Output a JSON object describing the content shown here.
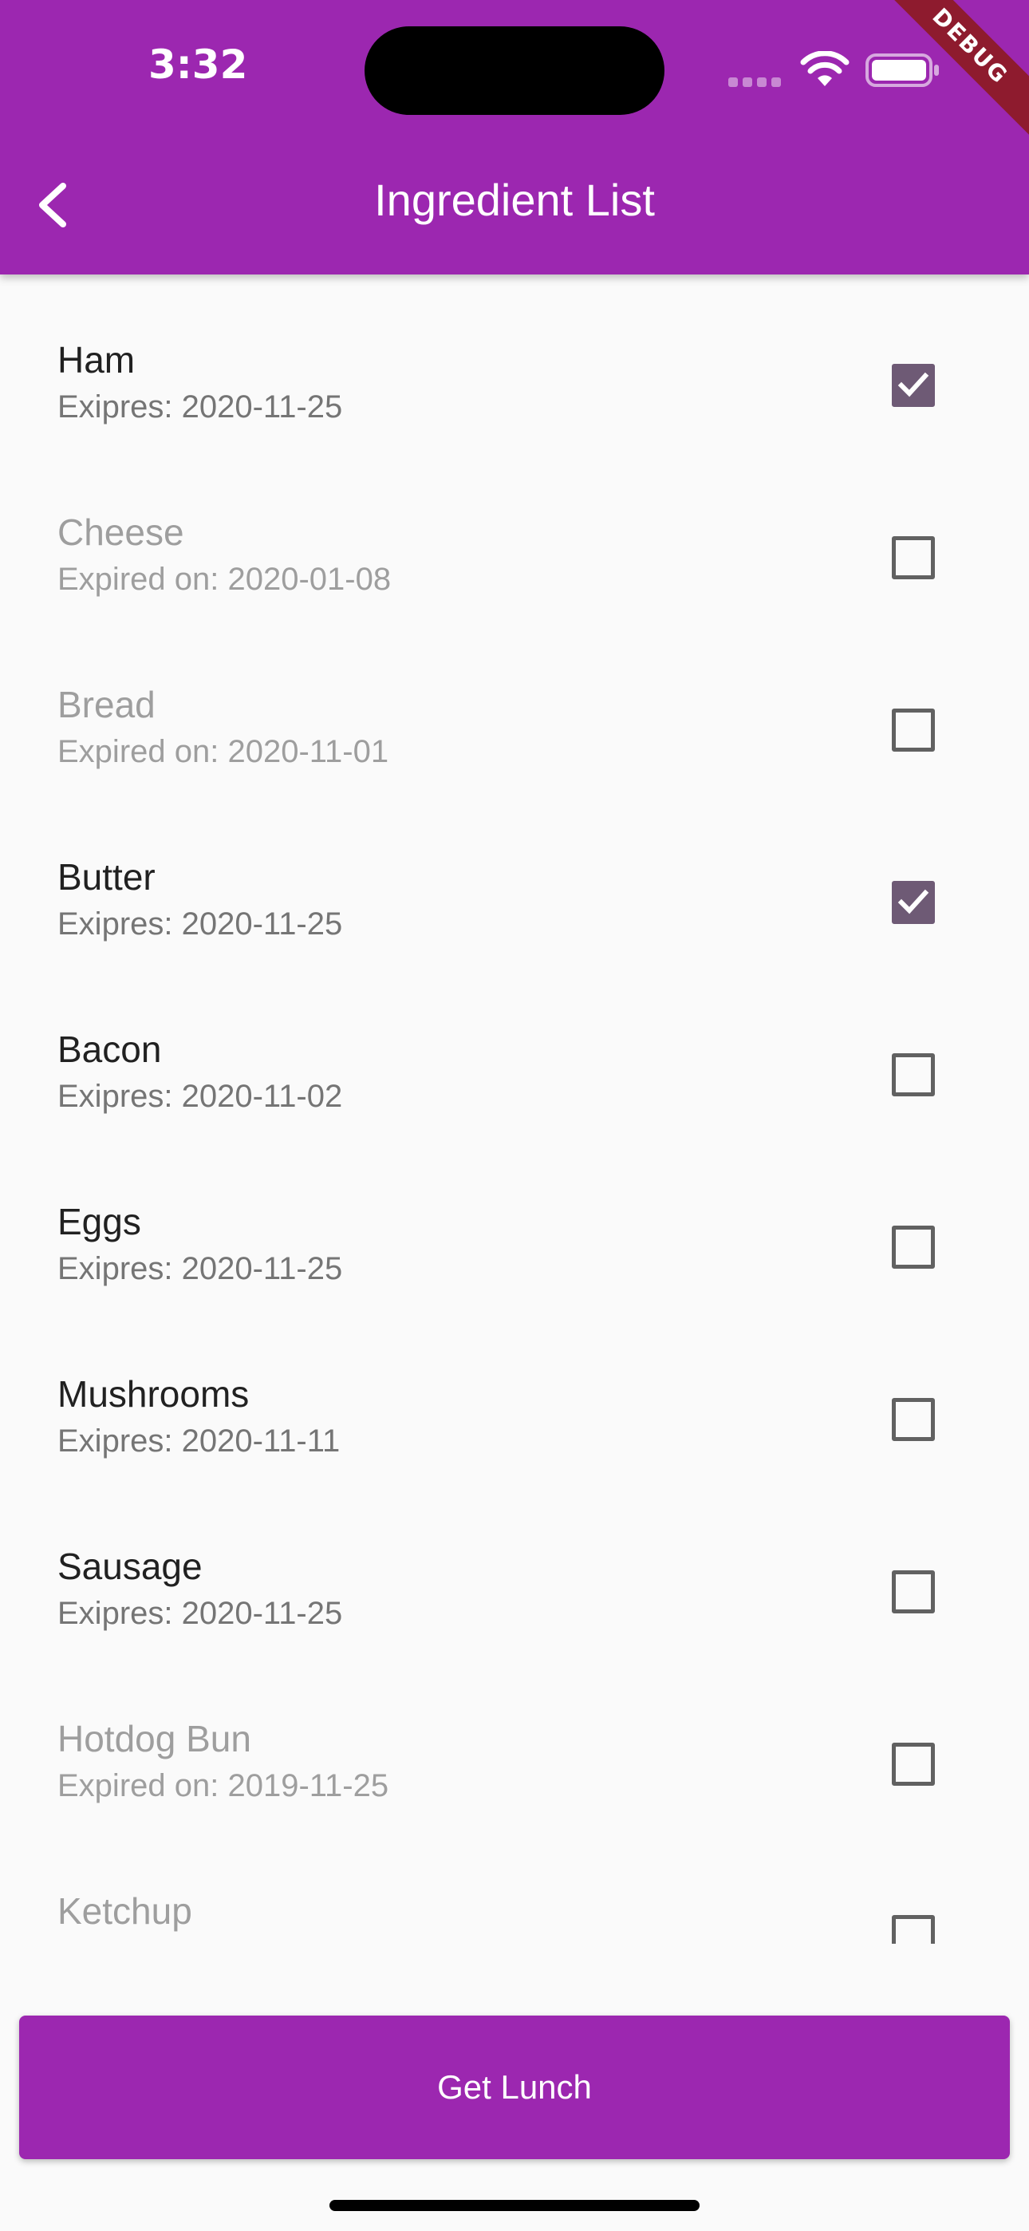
{
  "status_bar": {
    "time": "3:32",
    "debug_label": "DEBUG"
  },
  "app_bar": {
    "title": "Ingredient List"
  },
  "ingredients": [
    {
      "name": "Ham",
      "expiry": "Exipres: 2020-11-25",
      "checked": true,
      "expired": false
    },
    {
      "name": "Cheese",
      "expiry": "Expired on: 2020-01-08",
      "checked": false,
      "expired": true
    },
    {
      "name": "Bread",
      "expiry": "Expired on: 2020-11-01",
      "checked": false,
      "expired": true
    },
    {
      "name": "Butter",
      "expiry": "Exipres: 2020-11-25",
      "checked": true,
      "expired": false
    },
    {
      "name": "Bacon",
      "expiry": "Exipres: 2020-11-02",
      "checked": false,
      "expired": false
    },
    {
      "name": "Eggs",
      "expiry": "Exipres: 2020-11-25",
      "checked": false,
      "expired": false
    },
    {
      "name": "Mushrooms",
      "expiry": "Exipres: 2020-11-11",
      "checked": false,
      "expired": false
    },
    {
      "name": "Sausage",
      "expiry": "Exipres: 2020-11-25",
      "checked": false,
      "expired": false
    },
    {
      "name": "Hotdog Bun",
      "expiry": "Expired on: 2019-11-25",
      "checked": false,
      "expired": true
    },
    {
      "name": "Ketchup",
      "expiry": "",
      "checked": false,
      "expired": true
    }
  ],
  "actions": {
    "get_lunch_label": "Get Lunch"
  },
  "colors": {
    "primary": "#9c27b0",
    "checkbox_checked": "#6e5a75",
    "background": "#fafafa"
  }
}
